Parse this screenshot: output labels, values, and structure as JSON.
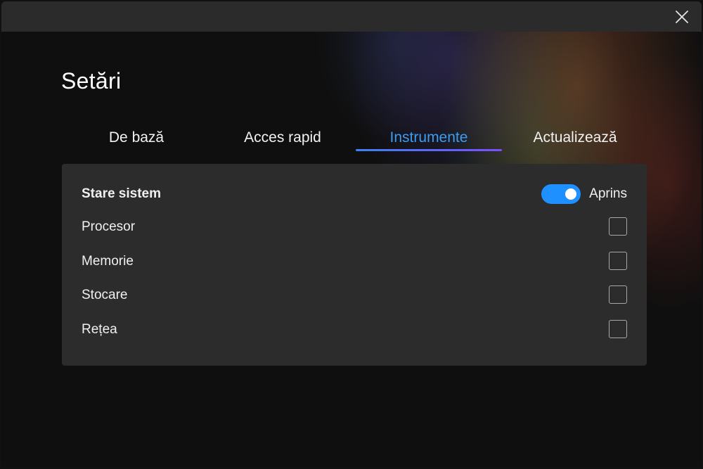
{
  "window": {
    "close_icon": "close-icon"
  },
  "page": {
    "title": "Setări"
  },
  "tabs": [
    {
      "label": "De bază",
      "active": false
    },
    {
      "label": "Acces rapid",
      "active": false
    },
    {
      "label": "Instrumente",
      "active": true
    },
    {
      "label": "Actualizează",
      "active": false
    }
  ],
  "panel": {
    "header": {
      "label": "Stare sistem",
      "toggle_state": "on",
      "toggle_label": "Aprins"
    },
    "items": [
      {
        "label": "Procesor",
        "checked": false
      },
      {
        "label": "Memorie",
        "checked": false
      },
      {
        "label": "Stocare",
        "checked": false
      },
      {
        "label": "Rețea",
        "checked": false
      }
    ]
  },
  "colors": {
    "accent": "#3b9cf0",
    "toggle": "#1e90ff",
    "panel_bg": "#2c2c2c",
    "titlebar_bg": "#2b2b2b"
  }
}
